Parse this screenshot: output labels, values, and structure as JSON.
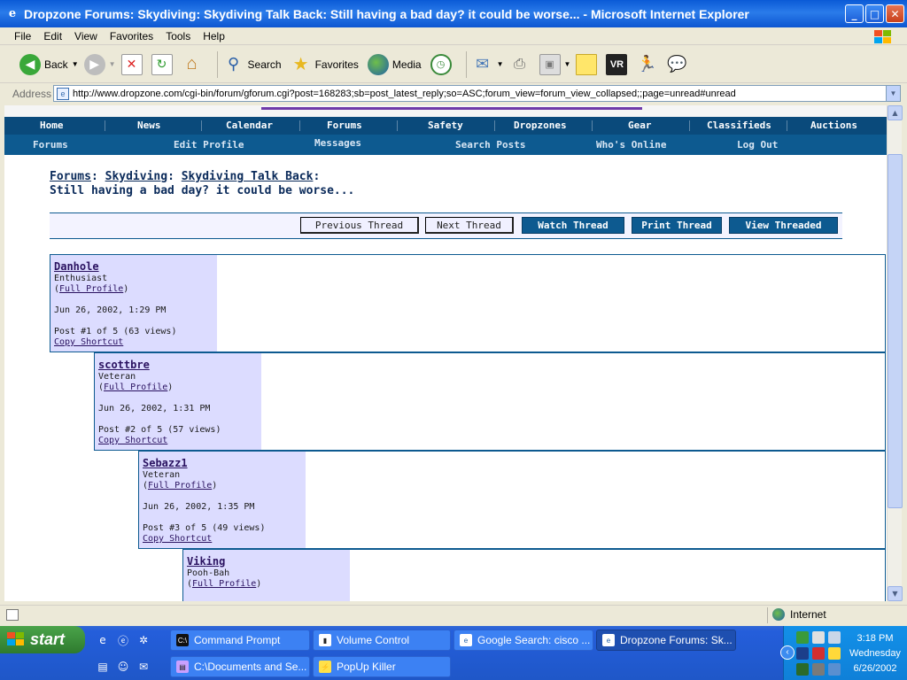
{
  "window": {
    "title": "Dropzone Forums: Skydiving: Skydiving Talk Back: Still having a bad day? it could be worse... - Microsoft Internet Explorer"
  },
  "menu": [
    "File",
    "Edit",
    "View",
    "Favorites",
    "Tools",
    "Help"
  ],
  "toolbar": {
    "back": "Back",
    "search": "Search",
    "favorites": "Favorites",
    "media": "Media"
  },
  "address": {
    "label": "Address",
    "url": "http://www.dropzone.com/cgi-bin/forum/gforum.cgi?post=168283;sb=post_latest_reply;so=ASC;forum_view=forum_view_collapsed;;page=unread#unread"
  },
  "nav_main": [
    "Home",
    "News",
    "Calendar",
    "Forums",
    "Safety",
    "Dropzones",
    "Gear",
    "Classifieds",
    "Auctions"
  ],
  "nav_sub": [
    "Forums",
    "Edit Profile",
    "Messages",
    "Search Posts",
    "Who's Online",
    "Log Out"
  ],
  "breadcrumb": {
    "forums": "Forums",
    "skydiving": "Skydiving",
    "talkback": "Skydiving Talk Back",
    "sep": ":",
    "thread_title": "Still having a bad day? it could be worse..."
  },
  "thread_buttons": {
    "prev": "Previous Thread",
    "next": "Next Thread",
    "watch": "Watch Thread",
    "print": "Print Thread",
    "threaded": "View Threaded"
  },
  "posts": [
    {
      "user": "Danhole",
      "rank": "Enthusiast",
      "profile": "Full Profile",
      "date": "Jun 26, 2002, 1:29 PM",
      "post_info": "Post #1 of 5 (63 views)",
      "shortcut": "Copy Shortcut",
      "indent": 0
    },
    {
      "user": "scottbre",
      "rank": "Veteran",
      "profile": "Full Profile",
      "date": "Jun 26, 2002, 1:31 PM",
      "post_info": "Post #2 of 5 (57 views)",
      "shortcut": "Copy Shortcut",
      "indent": 1
    },
    {
      "user": "Sebazz1",
      "rank": "Veteran",
      "profile": "Full Profile",
      "date": "Jun 26, 2002, 1:35 PM",
      "post_info": "Post #3 of 5 (49 views)",
      "shortcut": "Copy Shortcut",
      "indent": 2
    },
    {
      "user": "Viking",
      "rank": "Pooh-Bah",
      "profile": "Full Profile",
      "date": "",
      "post_info": "",
      "shortcut": "",
      "indent": 3
    }
  ],
  "status": {
    "zone": "Internet"
  },
  "taskbar": {
    "start": "start",
    "row1": [
      "Command Prompt",
      "Volume Control",
      "Google Search: cisco ...",
      "Dropzone Forums: Sk..."
    ],
    "row2": [
      "C:\\Documents and Se...",
      "PopUp Killer"
    ],
    "time": "3:18 PM",
    "day": "Wednesday",
    "date": "6/26/2002"
  },
  "colors": {
    "nav_dark": "#0a4a7b",
    "nav_sub": "#0d5a90",
    "post_side": "#dcdcff",
    "link": "#2a1260"
  }
}
